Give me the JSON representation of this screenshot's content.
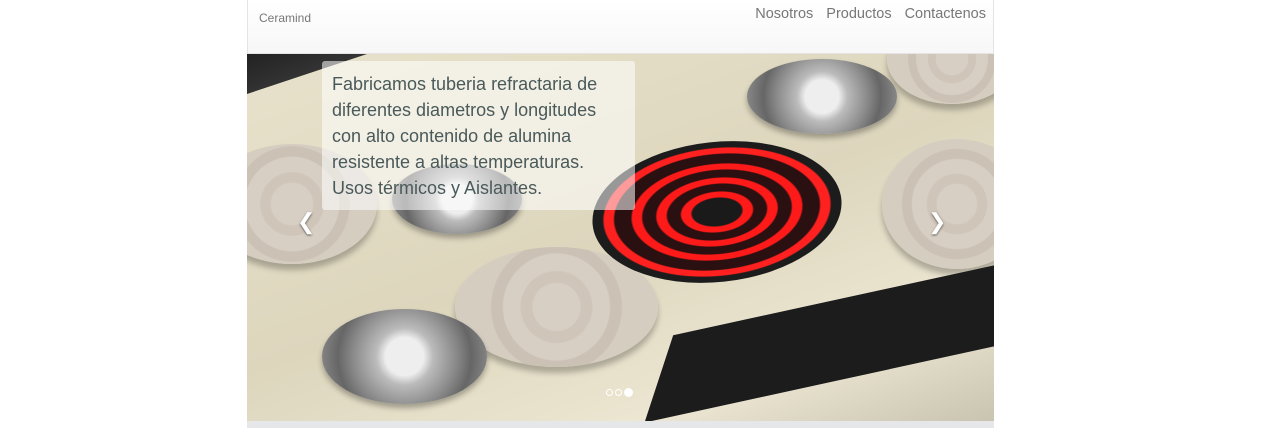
{
  "navbar": {
    "brand": "Ceramind",
    "links": [
      "Nosotros",
      "Productos",
      "Contactenos"
    ]
  },
  "carousel": {
    "caption": "Fabricamos tuberia refractaria de diferentes diametros y longitudes con alto contenido de alumina resistente a altas temperaturas. Usos térmicos y Aislantes.",
    "prev_icon": "chevron-left-icon",
    "next_icon": "chevron-right-icon",
    "slide_count": 3,
    "active_slide": 3
  }
}
